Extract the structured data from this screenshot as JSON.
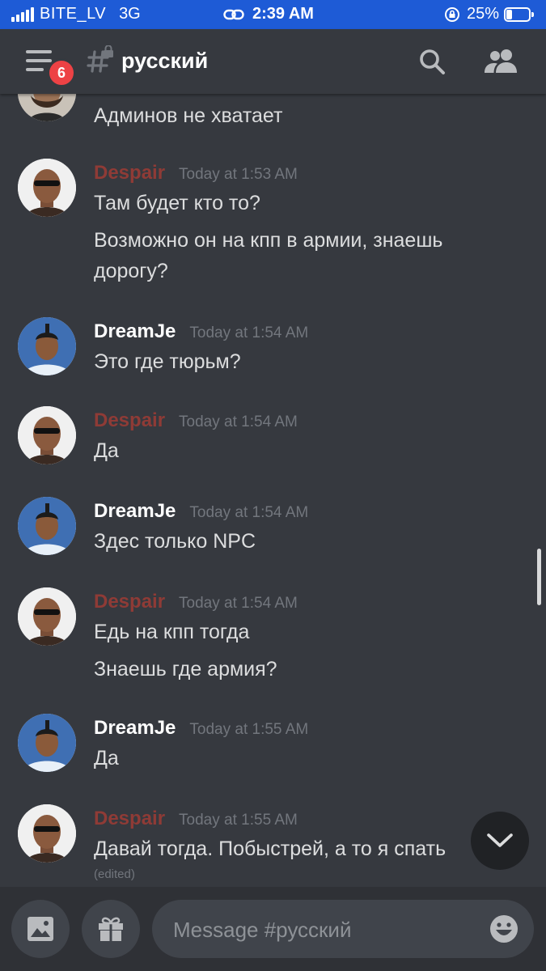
{
  "status_bar": {
    "carrier": "BITE_LV",
    "network": "3G",
    "time": "2:39 AM",
    "battery": "25%",
    "battery_level": 0.25
  },
  "header": {
    "unread_badge": "6",
    "channel_name": "русский"
  },
  "messages": [
    {
      "author": "",
      "timestamp": "",
      "lines": [
        "Админов не хватает"
      ]
    },
    {
      "author": "Despair",
      "timestamp": "Today at 1:53 AM",
      "lines": [
        "Там будет кто то?",
        "Возможно он на кпп в армии, знаешь дорогу?"
      ]
    },
    {
      "author": "DreamJe",
      "timestamp": "Today at 1:54 AM",
      "lines": [
        "Это где тюрьм?"
      ]
    },
    {
      "author": "Despair",
      "timestamp": "Today at 1:54 AM",
      "lines": [
        "Да"
      ]
    },
    {
      "author": "DreamJe",
      "timestamp": "Today at 1:54 AM",
      "lines": [
        "Здес только NPC"
      ]
    },
    {
      "author": "Despair",
      "timestamp": "Today at 1:54 AM",
      "lines": [
        "Едь на кпп тогда",
        "Знаешь где армия?"
      ]
    },
    {
      "author": "DreamJe",
      "timestamp": "Today at 1:55 AM",
      "lines": [
        "Да"
      ]
    },
    {
      "author": "Despair",
      "timestamp": "Today at 1:55 AM",
      "lines": [
        "Давай тогда. Побыстрей, а то я спать"
      ],
      "edited": "(edited)"
    }
  ],
  "composer": {
    "placeholder": "Message #русский"
  },
  "colors": {
    "background": "#36393f",
    "status_bar": "#1e5bd6",
    "badge": "#ed4245",
    "despair_role": "#8f3b36"
  }
}
